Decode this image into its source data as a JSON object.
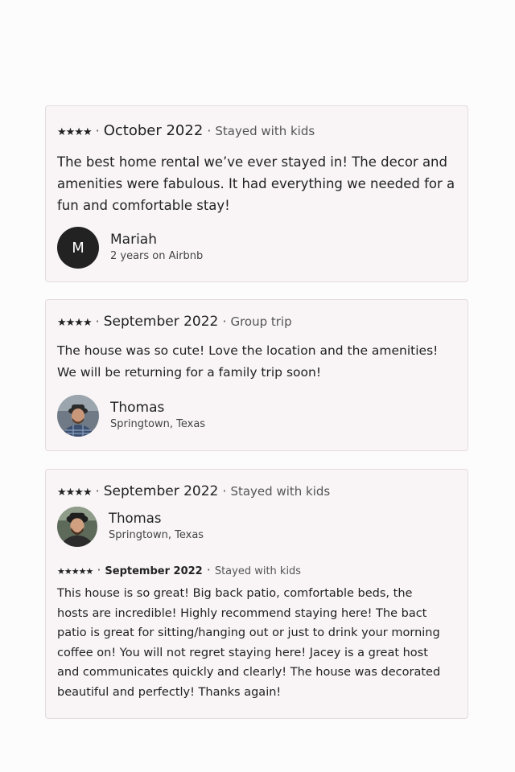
{
  "reviews": [
    {
      "stars": "★★★★",
      "separator_1": "·",
      "date": "October 2022",
      "separator_2": "·",
      "trip_type": "Stayed with kids",
      "text": "The best home rental we’ve ever stayed in! The decor and amenities were fabulous. It had everything we needed for a fun and comfortable stay!",
      "author": {
        "initial": "M",
        "name": "Mariah",
        "sub": "2 years on Airbnb"
      }
    },
    {
      "stars": "★★★★",
      "separator_1": "·",
      "date": "September 2022",
      "separator_2": "·",
      "trip_type": "Group trip",
      "text": "The house was so cute! Love the location and the amenities! We will be returning for a family trip soon!",
      "author": {
        "name": "Thomas",
        "sub": "Springtown, Texas"
      }
    },
    {
      "stars": "★★★★",
      "separator_1": "·",
      "date": "September 2022",
      "separator_2": "·",
      "trip_type": "Stayed with kids",
      "author": {
        "name": "Thomas",
        "sub": "Springtown, Texas"
      },
      "inner": {
        "stars": "★★★★★",
        "separator_1": "·",
        "date": "September 2022",
        "separator_2": "·",
        "trip_type": "Stayed with kids"
      },
      "text": "This house is so great! Big back patio, comfortable beds, the hosts are incredible! Highly recommend staying here! The bact patio is great for sitting/hanging out or just to drink your morning coffee on! You will not regret staying here! Jacey is a great host and communicates quickly and clearly! The house was decorated beautiful and perfectly! Thanks again!"
    }
  ],
  "colors": {
    "card_background": "#f9f5f6",
    "card_border": "#e3dcdf",
    "text_primary": "#222222",
    "text_secondary": "#555555",
    "avatar_dark": "#222222"
  }
}
